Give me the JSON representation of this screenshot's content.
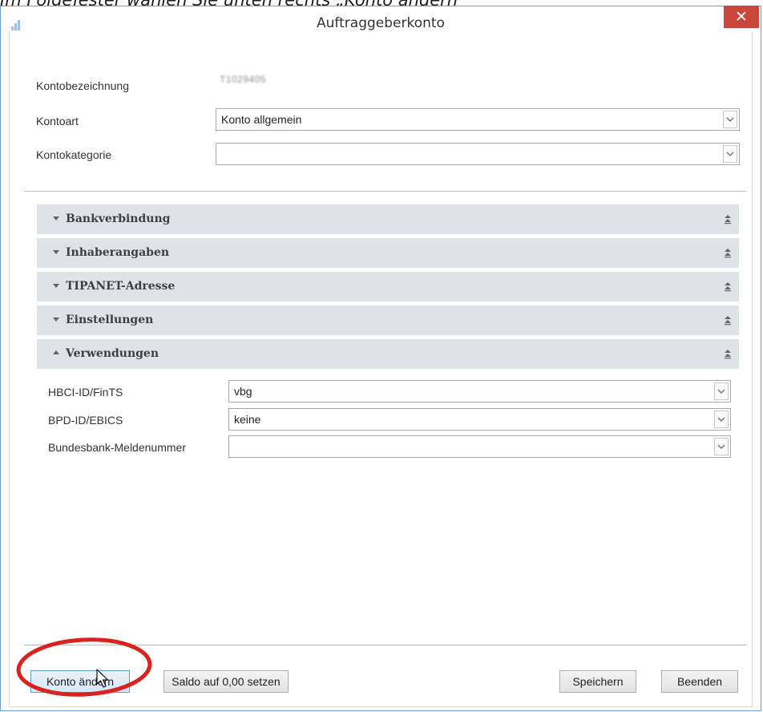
{
  "caption": "Im Folgefester wählen Sie unten rechts „Konto ändern\"",
  "window": {
    "title": "Auftraggeberkonto",
    "close_label": "✕"
  },
  "form": {
    "kontobezeichnung_label": "Kontobezeichnung",
    "kontobezeichnung_value": "T1029405",
    "kontoart_label": "Kontoart",
    "kontoart_value": "Konto allgemein",
    "kontokategorie_label": "Kontokategorie",
    "kontokategorie_value": ""
  },
  "sections": [
    {
      "title": "Bankverbindung",
      "expanded": false
    },
    {
      "title": "Inhaberangaben",
      "expanded": false
    },
    {
      "title": "TIPANET-Adresse",
      "expanded": false
    },
    {
      "title": "Einstellungen",
      "expanded": false
    },
    {
      "title": "Verwendungen",
      "expanded": true
    }
  ],
  "verwendungen": {
    "hbci_label": "HBCI-ID/FinTS",
    "hbci_value": "vbg",
    "bpd_label": "BPD-ID/EBICS",
    "bpd_value": "keine",
    "bundesbank_label": "Bundesbank-Meldenummer",
    "bundesbank_value": ""
  },
  "buttons": {
    "konto_aendern": "Konto ändern",
    "saldo": "Saldo auf 0,00 setzen",
    "speichern": "Speichern",
    "beenden": "Beenden"
  },
  "colors": {
    "section_bg": "#dfe2e6",
    "close_bg": "#c9463d",
    "highlight_ellipse": "#d9221c"
  }
}
